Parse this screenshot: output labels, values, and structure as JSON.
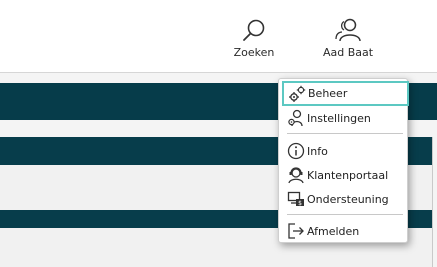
{
  "header": {
    "search_label": "Zoeken",
    "user_label": "Aad Baat",
    "search_icon": "search-icon",
    "user_icon": "users-icon"
  },
  "user_menu": {
    "items": [
      {
        "label": "Beheer",
        "icon": "gears-icon",
        "active": true
      },
      {
        "label": "Instellingen",
        "icon": "user-gear-icon"
      },
      {
        "label": "Info",
        "icon": "info-icon"
      },
      {
        "label": "Klantenportaal",
        "icon": "support-agent-icon"
      },
      {
        "label": "Ondersteuning",
        "icon": "remote-support-icon"
      },
      {
        "label": "Afmelden",
        "icon": "logout-icon"
      }
    ]
  },
  "colors": {
    "brand_dark": "#063c4a",
    "active_border": "#5cc8c2"
  }
}
